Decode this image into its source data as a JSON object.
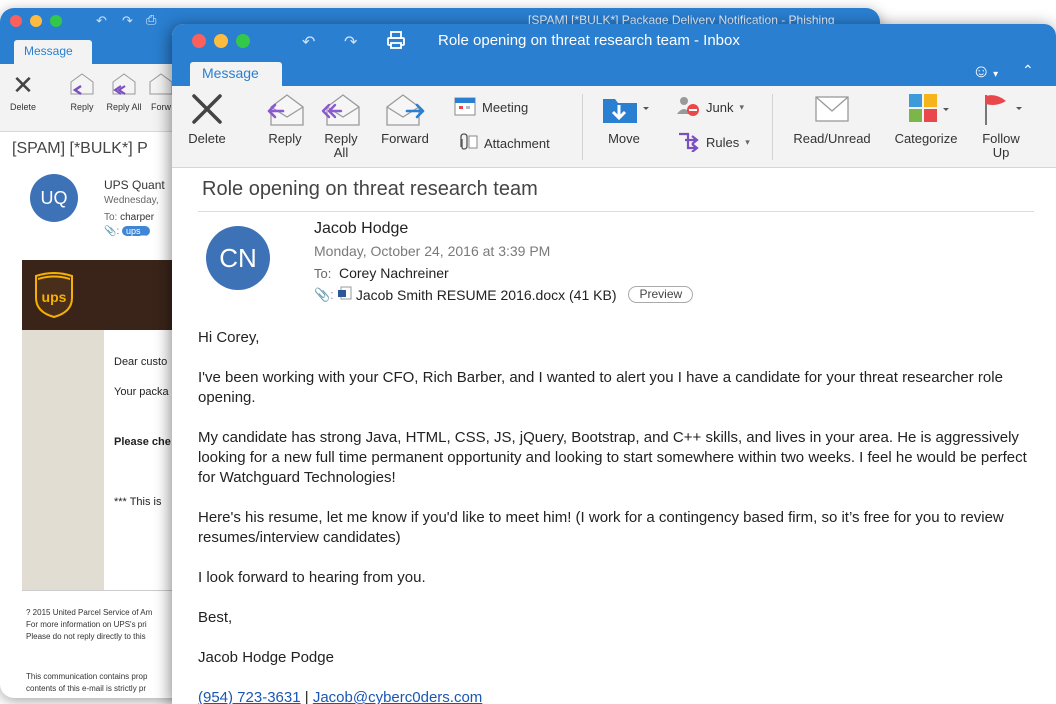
{
  "back_window": {
    "title": "[SPAM] [*BULK*] Package Delivery Notification - Phishing",
    "tab": "Message",
    "toolbar": [
      {
        "label": "Delete"
      },
      {
        "label": "Reply"
      },
      {
        "label": "Reply All"
      },
      {
        "label": "Forw"
      }
    ],
    "subject": "[SPAM] [*BULK*] P",
    "avatar_initials": "UQ",
    "sender": "UPS Quant",
    "date": "Wednesday,",
    "to_label": "To:",
    "to_value": "charper",
    "attachment": "ups_",
    "body_lines": [
      "Dear custo",
      "Your packa",
      "Please che",
      "*** This is"
    ],
    "footer_lines": [
      "? 2015 United Parcel Service of Am",
      "For more information on UPS's pri",
      "Please do not reply directly to this",
      "This communication contains prop",
      "contents of this e-mail is strictly pr"
    ]
  },
  "front_window": {
    "title": "Role opening on threat research team - Inbox",
    "tab": "Message",
    "toolbar": {
      "delete": "Delete",
      "reply": "Reply",
      "reply_all": "Reply All",
      "forward": "Forward",
      "meeting": "Meeting",
      "attachment": "Attachment",
      "move": "Move",
      "junk": "Junk",
      "rules": "Rules",
      "read_unread": "Read/Unread",
      "categorize": "Categorize",
      "follow_up": "Follow Up"
    },
    "email": {
      "subject": "Role opening on threat research team",
      "avatar_initials": "CN",
      "sender": "Jacob Hodge",
      "date": "Monday, October 24, 2016 at 3:39 PM",
      "to_label": "To:",
      "to_name": "Corey Nachreiner",
      "attachment_name": "Jacob Smith RESUME 2016.docx (41 KB)",
      "preview_label": "Preview",
      "body": {
        "greeting": "Hi Corey,",
        "p1": "I've been working with your CFO, Rich Barber, and I wanted to alert you I have a candidate for your threat researcher role opening.",
        "p2": "My candidate has strong Java, HTML, CSS, JS, jQuery, Bootstrap, and C++ skills, and lives in your area. He is aggressively looking for a new full time permanent opportunity and looking to start somewhere within two weeks. I feel he would be perfect for Watchguard Technologies!",
        "p3": "Here's his resume, let me know if you'd like to meet him! (I work for a contingency based firm, so it’s free for you to review resumes/interview candidates)",
        "p4": "I look forward to hearing from you.",
        "signoff": "Best,",
        "signature": "Jacob Hodge Podge",
        "phone": "(954) 723-3631",
        "separator": "|",
        "email": "Jacob@cyberc0ders.com"
      }
    }
  },
  "colors": {
    "titlebar_blue": "#2a7fd1",
    "avatar_blue": "#3e72b6",
    "ups_brown": "#3a2419",
    "ups_gold": "#f6b000",
    "link_blue": "#1a56b3",
    "flag_red": "#e8474c"
  },
  "icons": [
    "close-icon",
    "traffic-lights",
    "undo-icon",
    "redo-icon",
    "print-icon",
    "reply-icon",
    "reply-all-icon",
    "forward-icon",
    "meeting-icon",
    "paperclip-icon",
    "move-icon",
    "junk-icon",
    "rules-icon",
    "envelope-icon",
    "categorize-icon",
    "flag-icon",
    "smiley-icon",
    "chevron-up-icon"
  ]
}
